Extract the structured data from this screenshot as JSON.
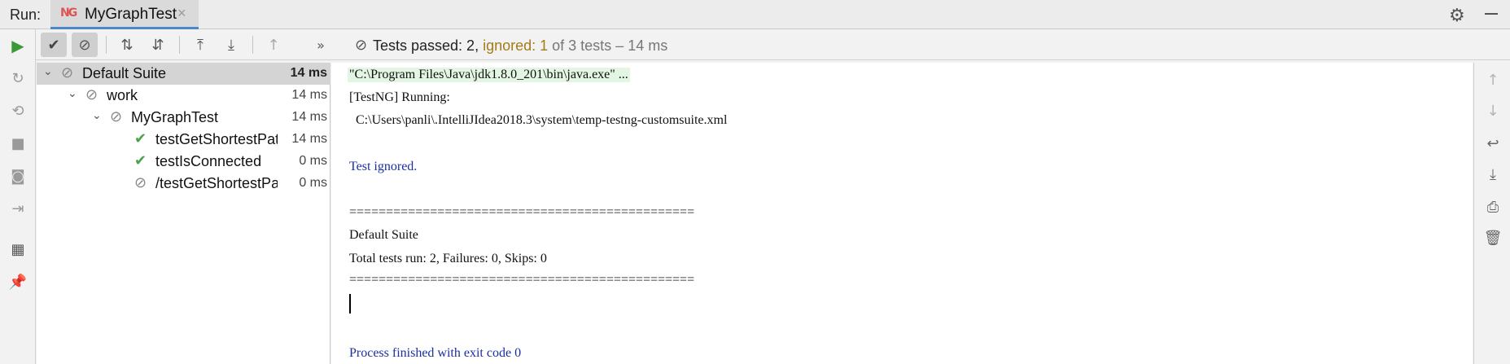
{
  "header": {
    "run_label": "Run:",
    "tab_icon": "NG",
    "tab_title": "MyGraphTest",
    "tab_close": "×"
  },
  "toolbar": {
    "status_prefix": "Tests passed: 2, ",
    "status_ignored": "ignored: 1",
    "status_suffix": " of 3 tests – 14 ms",
    "overflow": "»"
  },
  "tree": [
    {
      "label": "Default Suite",
      "time": "14 ms",
      "icon": "ignored-icon",
      "expanded": true,
      "level": 0
    },
    {
      "label": "work",
      "time": "14 ms",
      "icon": "ignored-icon",
      "expanded": true,
      "level": 1
    },
    {
      "label": "MyGraphTest",
      "time": "14 ms",
      "icon": "ignored-icon",
      "expanded": true,
      "level": 2
    },
    {
      "label": "testGetShortestPath",
      "time": "14 ms",
      "icon": "passed-icon",
      "level": 3
    },
    {
      "label": "testIsConnected",
      "time": "0 ms",
      "icon": "passed-icon",
      "level": 3
    },
    {
      "label": "/testGetShortestPath",
      "time": "0 ms",
      "icon": "ignored-icon",
      "level": 3
    }
  ],
  "console": {
    "lines": [
      "\"C:\\Program Files\\Java\\jdk1.8.0_201\\bin\\java.exe\" ...",
      "[TestNG] Running:",
      "  C:\\Users\\panli\\.IntelliJIdea2018.3\\system\\temp-testng-customsuite.xml",
      "Test ignored.",
      "===============================================",
      "Default Suite",
      "Total tests run: 2, Failures: 0, Skips: 0",
      "===============================================",
      "Process finished with exit code 0"
    ]
  },
  "colors": {
    "accent": "#4a88c7",
    "pass": "#4ba34b",
    "ignored_text": "#a37b1a",
    "console_blue": "#1b2fa0",
    "command_highlight": "#e3f6e3"
  }
}
